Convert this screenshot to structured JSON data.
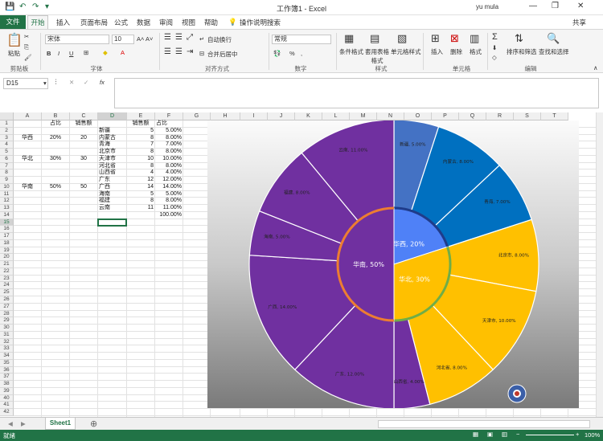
{
  "titlebar": {
    "title": "工作簿1 - Excel",
    "user": "yu mula",
    "min_glyph": "—",
    "restore_glyph": "❐",
    "close_glyph": "✕"
  },
  "tabs": {
    "file": "文件",
    "home": "开始",
    "items": [
      "插入",
      "页面布局",
      "公式",
      "数据",
      "审阅",
      "视图",
      "帮助"
    ],
    "tell_me": "操作说明搜索",
    "share": "共享"
  },
  "ribbon": {
    "paste": "粘贴",
    "clipboard": "剪贴板",
    "font_name": "宋体",
    "font_size": "10",
    "font_group": "字体",
    "align_group": "对齐方式",
    "wrap": "自动换行",
    "merge": "合并后居中",
    "num_format": "常规",
    "number_group": "数字",
    "cond_format": "条件格式",
    "table_format": "套用表格格式",
    "cell_style": "单元格样式",
    "style_group": "样式",
    "insert": "插入",
    "delete": "删除",
    "format": "格式",
    "cells_group": "单元格",
    "sort_filter": "排序和筛选",
    "find_select": "查找和选择",
    "edit_group": "编辑",
    "pct": "%",
    "comma": ",",
    "bold": "B",
    "italic": "I",
    "underline": "U",
    "font_color_a": "A",
    "inc_dec": "A˄ A˅"
  },
  "formula_bar": {
    "name_box": "D15",
    "cancel": "✕",
    "confirm": "✓",
    "fx": "fx",
    "value": ""
  },
  "columns": [
    "A",
    "B",
    "C",
    "D",
    "E",
    "F",
    "G",
    "H",
    "I",
    "J",
    "K",
    "L",
    "M",
    "N",
    "O",
    "P",
    "Q",
    "R",
    "S",
    "T"
  ],
  "rows": [
    "1",
    "2",
    "3",
    "4",
    "5",
    "6",
    "7",
    "8",
    "9",
    "10",
    "11",
    "12",
    "13",
    "14",
    "15",
    "16",
    "17",
    "18",
    "19",
    "20",
    "21",
    "22",
    "23",
    "24",
    "25",
    "26",
    "27",
    "28",
    "29",
    "30",
    "31",
    "32",
    "33",
    "34",
    "35",
    "36",
    "37",
    "38",
    "39",
    "40",
    "41",
    "42"
  ],
  "table1": {
    "headers": [
      "占比",
      "销售额"
    ],
    "rows": [
      {
        "region": "华西",
        "share": "20%",
        "sales": "20"
      },
      {
        "region": "华北",
        "share": "30%",
        "sales": "30"
      },
      {
        "region": "华南",
        "share": "50%",
        "sales": "50"
      }
    ]
  },
  "table2": {
    "headers": [
      "销售额",
      "占比"
    ],
    "rows": [
      {
        "name": "新疆",
        "sales": "5",
        "share": "5.00%"
      },
      {
        "name": "内蒙古",
        "sales": "8",
        "share": "8.00%"
      },
      {
        "name": "青海",
        "sales": "7",
        "share": "7.00%"
      },
      {
        "name": "北京市",
        "sales": "8",
        "share": "8.00%"
      },
      {
        "name": "天津市",
        "sales": "10",
        "share": "10.00%"
      },
      {
        "name": "河北省",
        "sales": "8",
        "share": "8.00%"
      },
      {
        "name": "山西省",
        "sales": "4",
        "share": "4.00%"
      },
      {
        "name": "广东",
        "sales": "12",
        "share": "12.00%"
      },
      {
        "name": "广西",
        "sales": "14",
        "share": "14.00%"
      },
      {
        "name": "海南",
        "sales": "5",
        "share": "5.00%"
      },
      {
        "name": "福建",
        "sales": "8",
        "share": "8.00%"
      },
      {
        "name": "云南",
        "sales": "11",
        "share": "11.00%"
      }
    ],
    "total": "100.00%"
  },
  "chart_data": {
    "type": "pie",
    "inner": [
      {
        "label": "华西, 20%",
        "value": 20,
        "color": "#4f81f7"
      },
      {
        "label": "华北, 30%",
        "value": 30,
        "color": "#ffc000"
      },
      {
        "label": "华南, 50%",
        "value": 50,
        "color": "#7030a0"
      }
    ],
    "outer": [
      {
        "label": "新疆, 5.00%",
        "value": 5,
        "color": "#4472c4"
      },
      {
        "label": "内蒙古, 8.00%",
        "value": 8,
        "color": "#0070c0"
      },
      {
        "label": "青海, 7.00%",
        "value": 7,
        "color": "#0070c0"
      },
      {
        "label": "北京市, 8.00%",
        "value": 8,
        "color": "#ffc000"
      },
      {
        "label": "天津市, 10.00%",
        "value": 10,
        "color": "#ffc000"
      },
      {
        "label": "河北省, 8.00%",
        "value": 8,
        "color": "#ffc000"
      },
      {
        "label": "山西省, 4.00%",
        "value": 4,
        "color": "#7030a0"
      },
      {
        "label": "广东, 12.00%",
        "value": 12,
        "color": "#7030a0"
      },
      {
        "label": "广西, 14.00%",
        "value": 14,
        "color": "#7030a0"
      },
      {
        "label": "海南, 5.00%",
        "value": 5,
        "color": "#7030a0"
      },
      {
        "label": "福建, 8.00%",
        "value": 8,
        "color": "#7030a0"
      },
      {
        "label": "云南, 11.00%",
        "value": 11,
        "color": "#7030a0"
      }
    ],
    "background": "gradient-gray"
  },
  "sheets": {
    "active": "Sheet1",
    "add": "⊕"
  },
  "status": {
    "ready": "就绪",
    "zoom": "100%"
  }
}
